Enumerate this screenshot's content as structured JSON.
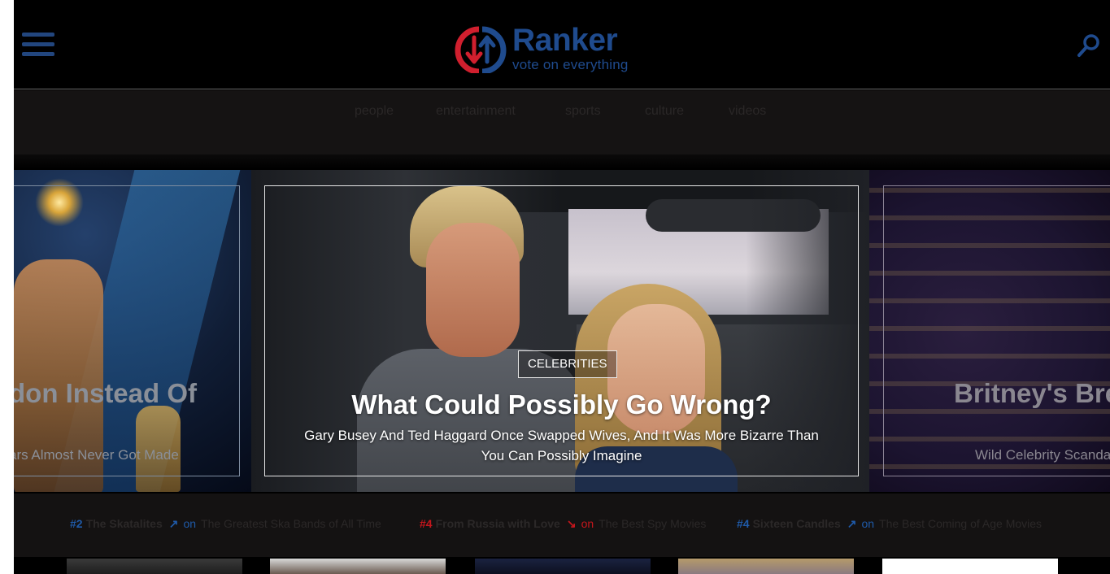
{
  "header": {
    "logo_name": "Ranker",
    "logo_tagline": "vote on everything",
    "menu_icon": "hamburger-menu-icon",
    "search_icon": "search-icon",
    "accent_color": "#1f4b8e",
    "logo_red": "#d01f2e"
  },
  "nav": {
    "items": [
      {
        "label": "people"
      },
      {
        "label": "entertainment"
      },
      {
        "label": "sports"
      },
      {
        "label": "culture"
      },
      {
        "label": "videos"
      }
    ]
  },
  "carousel": {
    "left": {
      "title": "don Instead Of",
      "subtitle": "ars Almost Never Got Made"
    },
    "main": {
      "category": "CELEBRITIES",
      "title": "What Could Possibly Go Wrong?",
      "subtitle": "Gary Busey And Ted Haggard Once Swapped Wives, And It Was More Bizarre Than You Can Possibly Imagine"
    },
    "right": {
      "title": "Britney's Bre",
      "subtitle": "Wild Celebrity Scandal"
    }
  },
  "trending": [
    {
      "rank": "#2",
      "name": "The Skatalites",
      "direction": "up",
      "on": "on",
      "list": "The Greatest Ska Bands of All Time",
      "color": "#1f5aa8"
    },
    {
      "rank": "#4",
      "name": "From Russia with Love",
      "direction": "down",
      "on": "on",
      "list": "The Best Spy Movies",
      "color": "#c4161c"
    },
    {
      "rank": "#4",
      "name": "Sixteen Candles",
      "direction": "up",
      "on": "on",
      "list": "The Best Coming of Age Movies",
      "color": "#1f5aa8"
    }
  ]
}
